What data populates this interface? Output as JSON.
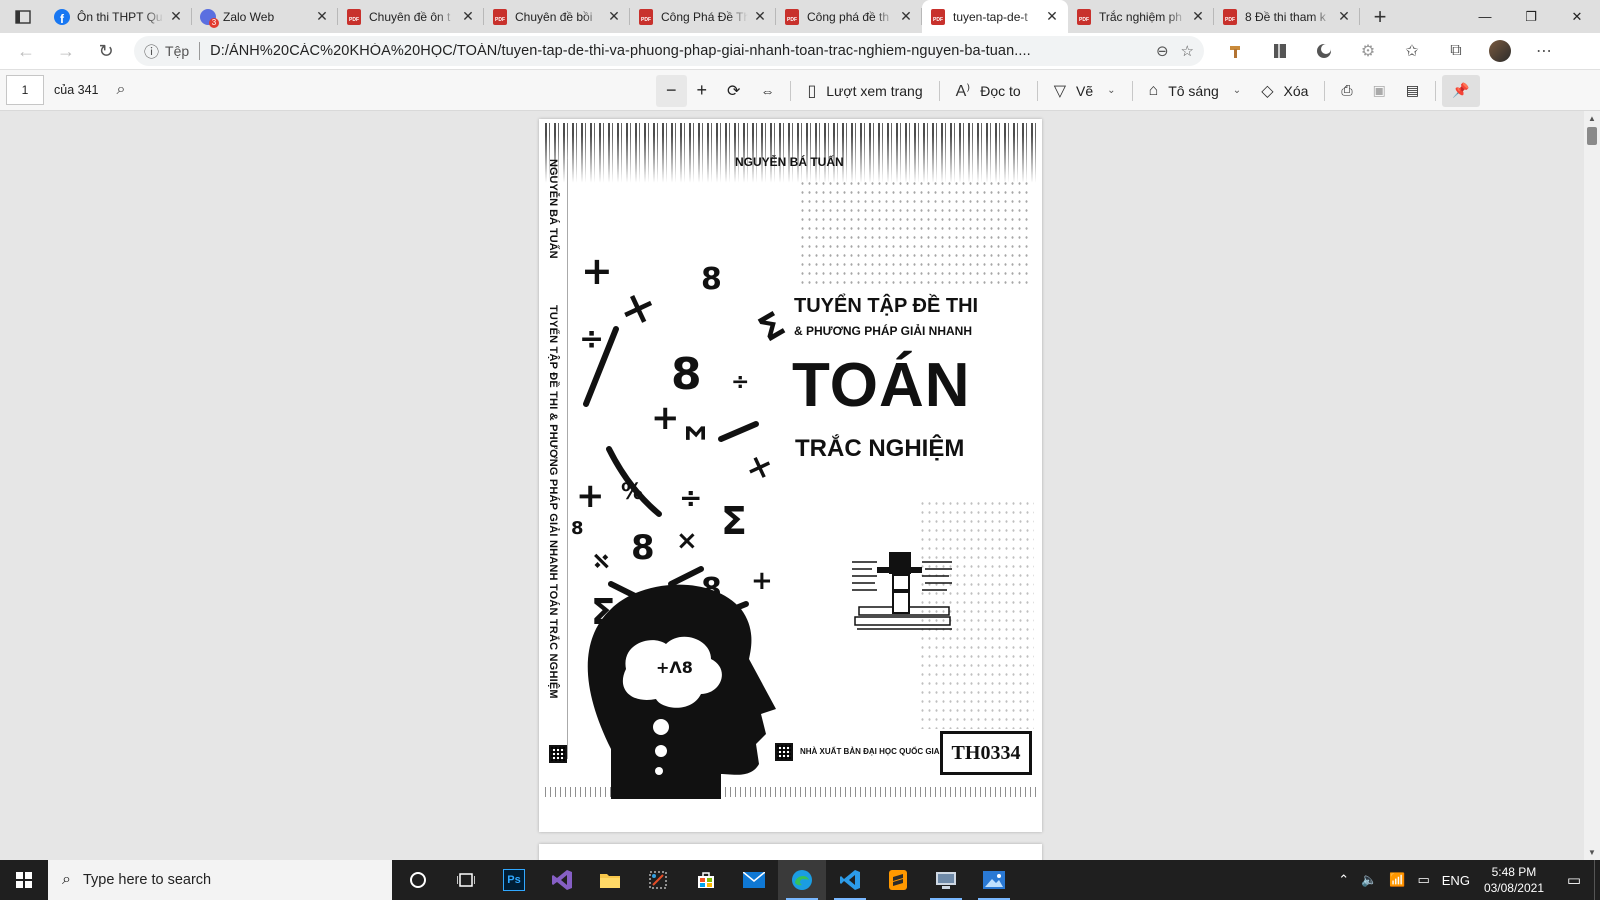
{
  "browser": {
    "tabs": [
      {
        "title": "Ôn thi THPT Qu",
        "icon": "facebook-icon",
        "active": false
      },
      {
        "title": "Zalo Web",
        "icon": "zalo-icon",
        "badge": "3",
        "active": false
      },
      {
        "title": "Chuyên đề ôn t",
        "icon": "pdf-icon",
        "active": false
      },
      {
        "title": "Chuyên đề bồi",
        "icon": "pdf-icon",
        "active": false
      },
      {
        "title": "Công Phá Đề Th",
        "icon": "pdf-icon",
        "active": false
      },
      {
        "title": "Công phá đề th",
        "icon": "pdf-icon",
        "active": false
      },
      {
        "title": "tuyen-tap-de-t",
        "icon": "pdf-icon",
        "active": true
      },
      {
        "title": "Trắc nghiệm ph",
        "icon": "pdf-icon",
        "active": false
      },
      {
        "title": "8 Đề thi tham k",
        "icon": "pdf-icon",
        "active": false
      }
    ],
    "address": {
      "scheme_label": "Tệp",
      "url": "D:/ẢNH%20CÁC%20KHÓA%20HỌC/TOÁN/tuyen-tap-de-thi-va-phuong-phap-giai-nhanh-toan-trac-nghiem-nguyen-ba-tuan...."
    }
  },
  "pdf_toolbar": {
    "page_number": "1",
    "page_count": "của 341",
    "page_view_label": "Lượt xem trang",
    "read_aloud_label": "Đọc to",
    "draw_label": "Vẽ",
    "highlight_label": "Tô sáng",
    "erase_label": "Xóa"
  },
  "document": {
    "author": "NGUYỄN BÁ TUẤN",
    "title_line1": "TUYỂN TẬP ĐỀ THI",
    "title_line2": "& PHƯƠNG PHÁP GIẢI NHANH",
    "title_line3": "TOÁN",
    "title_line4": "TRẮC NGHIỆM",
    "spine_author": "NGUYỄN BÁ TUẤN",
    "spine_title": "TUYỂN TẬP ĐỀ THI & PHƯƠNG PHÁP GIẢI NHANH   TOÁN TRẮC NGHIỆM",
    "publisher": "NHÀ XUẤT BẢN ĐẠI HỌC QUỐC GIA",
    "code": "TH0334"
  },
  "taskbar": {
    "search_placeholder": "Type here to search",
    "apps": [
      "task-view",
      "photoshop",
      "visual-studio",
      "file-explorer",
      "snipping-tool",
      "store",
      "mail",
      "edge",
      "vscode",
      "sublime-text",
      "remote-desktop",
      "photos"
    ],
    "language": "ENG",
    "time": "5:48 PM",
    "date": "03/08/2021"
  }
}
